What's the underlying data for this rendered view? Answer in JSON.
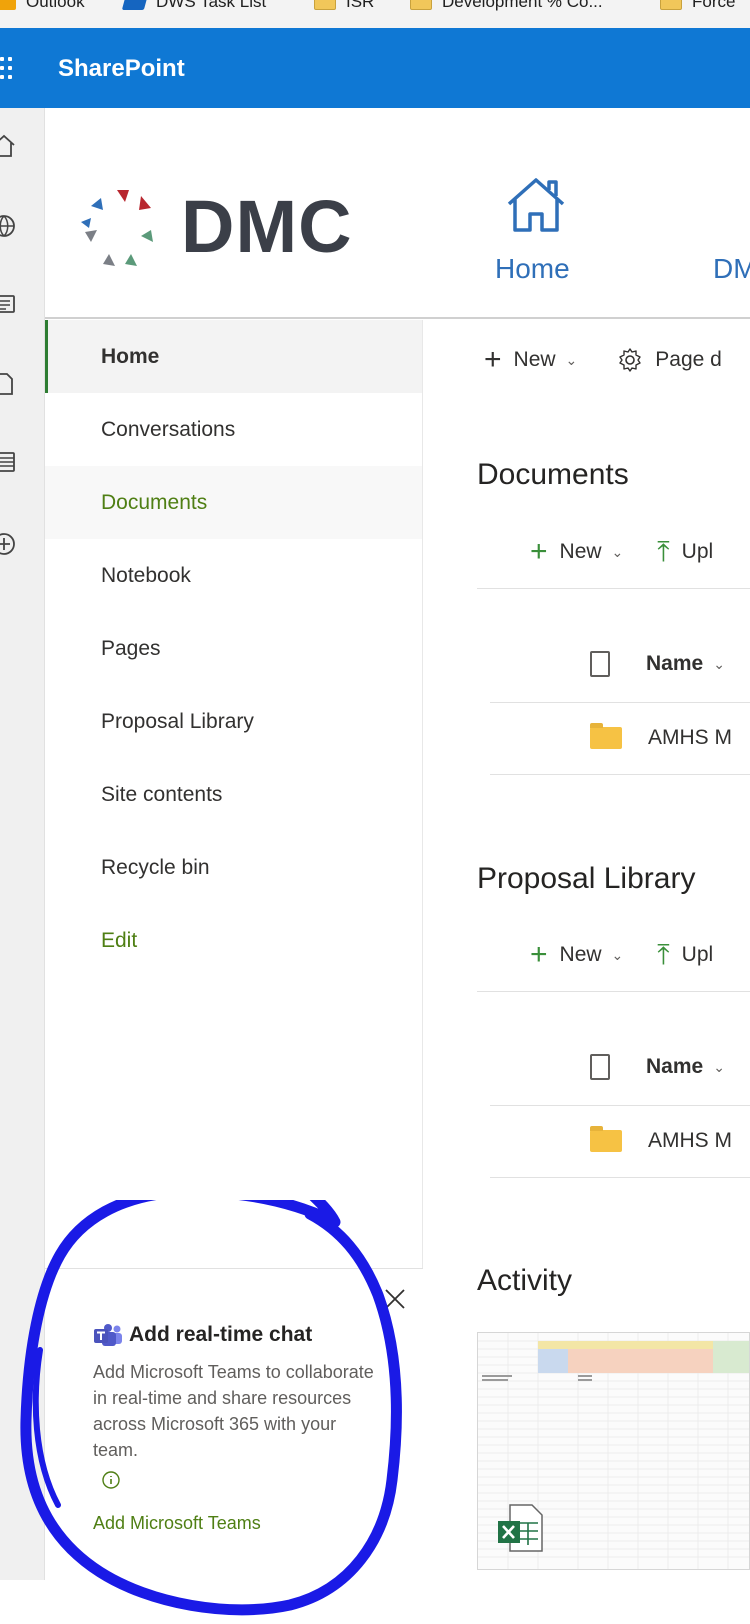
{
  "bookmarks": [
    {
      "label": "Outlook",
      "icon": "outlook-icon"
    },
    {
      "label": "DWS Task List",
      "icon": "dws-icon"
    },
    {
      "label": "ISR",
      "icon": "folder-icon"
    },
    {
      "label": "Development % Co...",
      "icon": "folder-icon"
    },
    {
      "label": "Force",
      "icon": "folder-icon"
    }
  ],
  "suite": {
    "title": "SharePoint"
  },
  "site": {
    "logo_text": "DMC",
    "hub_nav": [
      {
        "label": "Home"
      },
      {
        "label": "DM"
      }
    ]
  },
  "leftnav": {
    "items": [
      {
        "label": "Home"
      },
      {
        "label": "Conversations"
      },
      {
        "label": "Documents"
      },
      {
        "label": "Notebook"
      },
      {
        "label": "Pages"
      },
      {
        "label": "Proposal Library"
      },
      {
        "label": "Site contents"
      },
      {
        "label": "Recycle bin"
      },
      {
        "label": "Edit"
      }
    ]
  },
  "commandbar": {
    "new_label": "New",
    "page_label": "Page d"
  },
  "documents": {
    "title": "Documents",
    "new_label": "New",
    "upload_label": "Upl",
    "column_name": "Name",
    "rows": [
      {
        "name": "AMHS M"
      }
    ]
  },
  "proposal_library": {
    "title": "Proposal Library",
    "new_label": "New",
    "upload_label": "Upl",
    "column_name": "Name",
    "rows": [
      {
        "name": "AMHS M"
      }
    ]
  },
  "activity": {
    "title": "Activity"
  },
  "teams_callout": {
    "title": "Add real-time chat",
    "description": "Add Microsoft Teams to collaborate in real-time and share resources across Microsoft 365 with your team.",
    "link": "Add Microsoft Teams"
  },
  "colors": {
    "suite_bar": "#0f78d4",
    "accent_green": "#4f7f14",
    "hub_link_blue": "#2f6fb8",
    "annotation_blue": "#1a1ae6"
  }
}
